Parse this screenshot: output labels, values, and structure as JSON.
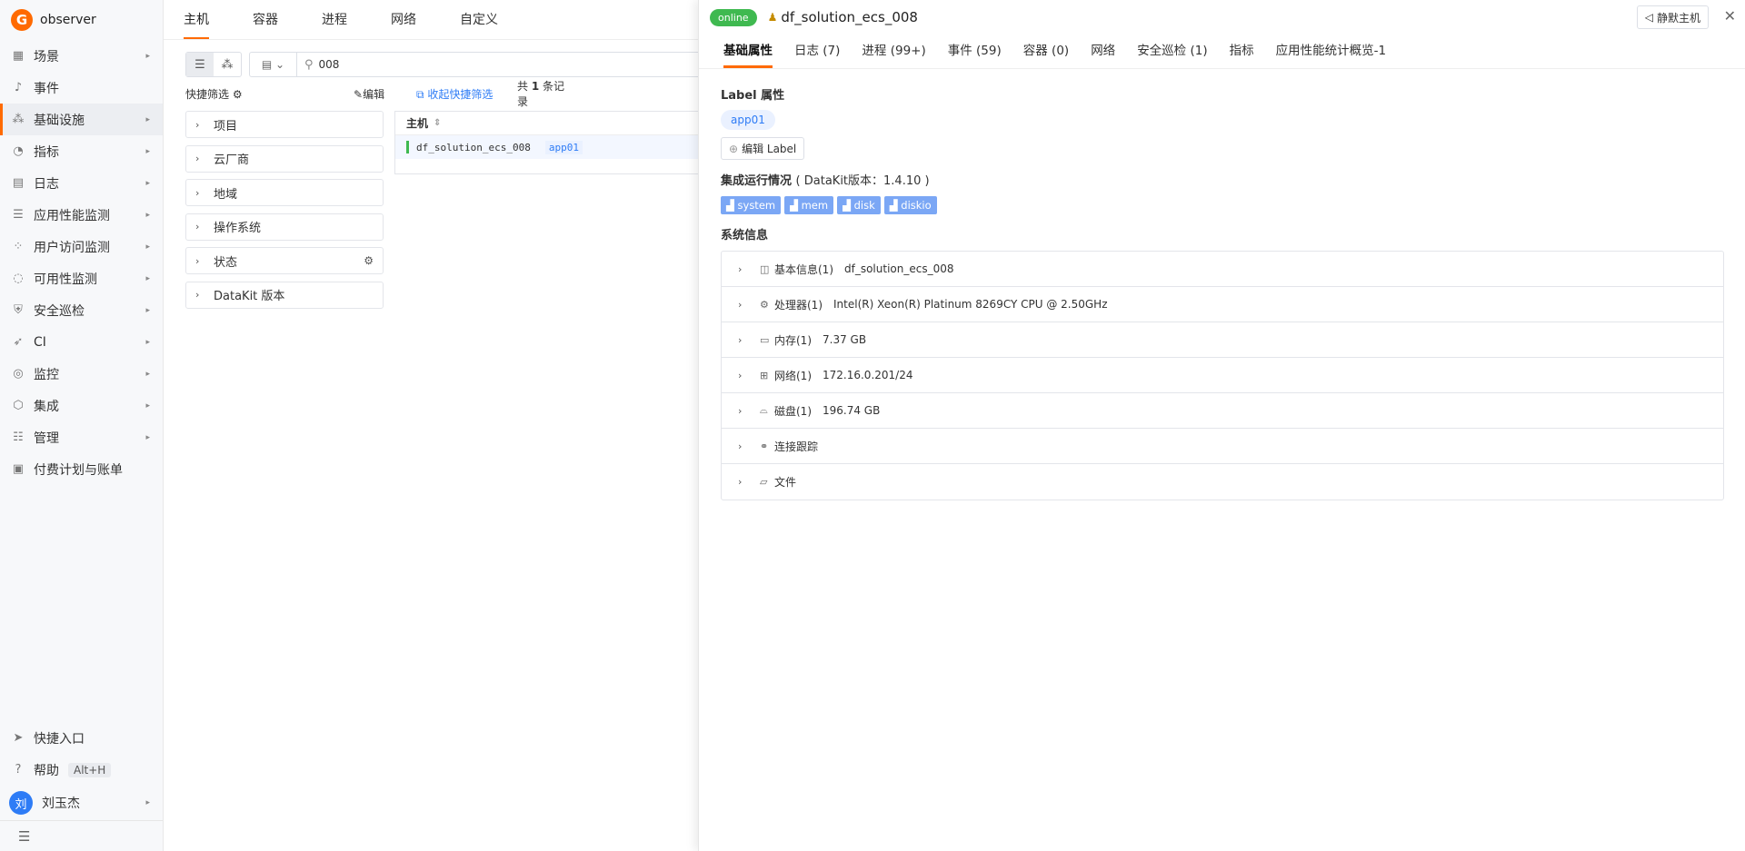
{
  "sidebar": {
    "brand": "observer",
    "items": [
      {
        "label": "场景",
        "icon": "dashboard-icon",
        "glyph": "▦"
      },
      {
        "label": "事件",
        "icon": "bell-icon",
        "glyph": "♪"
      },
      {
        "label": "基础设施",
        "icon": "infrastructure-icon",
        "glyph": "⁂"
      },
      {
        "label": "指标",
        "icon": "metric-icon",
        "glyph": "◔"
      },
      {
        "label": "日志",
        "icon": "log-icon",
        "glyph": "▤"
      },
      {
        "label": "应用性能监测",
        "icon": "apm-icon",
        "glyph": "☰"
      },
      {
        "label": "用户访问监测",
        "icon": "rum-icon",
        "glyph": "⁘"
      },
      {
        "label": "可用性监测",
        "icon": "synthetic-icon",
        "glyph": "◌"
      },
      {
        "label": "安全巡检",
        "icon": "shield-icon",
        "glyph": "⛨"
      },
      {
        "label": "CI",
        "icon": "rocket-icon",
        "glyph": "➶"
      },
      {
        "label": "监控",
        "icon": "monitor-icon",
        "glyph": "◎"
      },
      {
        "label": "集成",
        "icon": "integration-icon",
        "glyph": "⬡"
      },
      {
        "label": "管理",
        "icon": "settings-sliders-icon",
        "glyph": "☷"
      },
      {
        "label": "付费计划与账单",
        "icon": "billing-icon",
        "glyph": "▣"
      }
    ],
    "quick_entry": "快捷入口",
    "help": "帮助",
    "help_shortcut": "Alt+H",
    "user_initial": "刘",
    "user_name": "刘玉杰"
  },
  "main": {
    "tabs": [
      "主机",
      "容器",
      "进程",
      "网络",
      "自定义"
    ],
    "search_value": "008",
    "quick_filter_title": "快捷筛选",
    "edit": "编辑",
    "collapse_filter": "收起快捷筛选",
    "count_prefix": "共",
    "count_value": "1",
    "count_suffix": "条记录",
    "filters": [
      "项目",
      "云厂商",
      "地域",
      "操作系统",
      "状态",
      "DataKit 版本"
    ],
    "table_header": "主机",
    "rows": [
      {
        "host": "df_solution_ecs_008",
        "label": "app01"
      }
    ]
  },
  "drawer": {
    "status": "online",
    "title": "df_solution_ecs_008",
    "mute_button": "静默主机",
    "tabs": [
      "基础属性",
      "日志 (7)",
      "进程 (99+)",
      "事件 (59)",
      "容器 (0)",
      "网络",
      "安全巡检 (1)",
      "指标",
      "应用性能统计概览-1"
    ],
    "label_section_title": "Label 属性",
    "label_chip": "app01",
    "edit_label": "编辑 Label",
    "integration_title": "集成运行情况",
    "integration_version": "( DataKit版本：1.4.10 )",
    "integrations": [
      "system",
      "mem",
      "disk",
      "diskio"
    ],
    "system_title": "系统信息",
    "system_rows": [
      {
        "name": "基本信息(1)",
        "value": "df_solution_ecs_008",
        "icon": "info-icon"
      },
      {
        "name": "处理器(1)",
        "value": "Intel(R) Xeon(R) Platinum 8269CY CPU @ 2.50GHz",
        "icon": "cpu-icon"
      },
      {
        "name": "内存(1)",
        "value": "7.37 GB",
        "icon": "memory-icon"
      },
      {
        "name": "网络(1)",
        "value": "172.16.0.201/24",
        "icon": "network-icon"
      },
      {
        "name": "磁盘(1)",
        "value": "196.74 GB",
        "icon": "disk-icon"
      },
      {
        "name": "连接跟踪",
        "value": "",
        "icon": "conntrack-icon"
      },
      {
        "name": "文件",
        "value": "",
        "icon": "folder-icon"
      }
    ]
  },
  "colors": {
    "accent": "#ff6a00",
    "online": "#3fb950",
    "link": "#2e7cf6",
    "integration_chip": "#7ba7f5"
  }
}
